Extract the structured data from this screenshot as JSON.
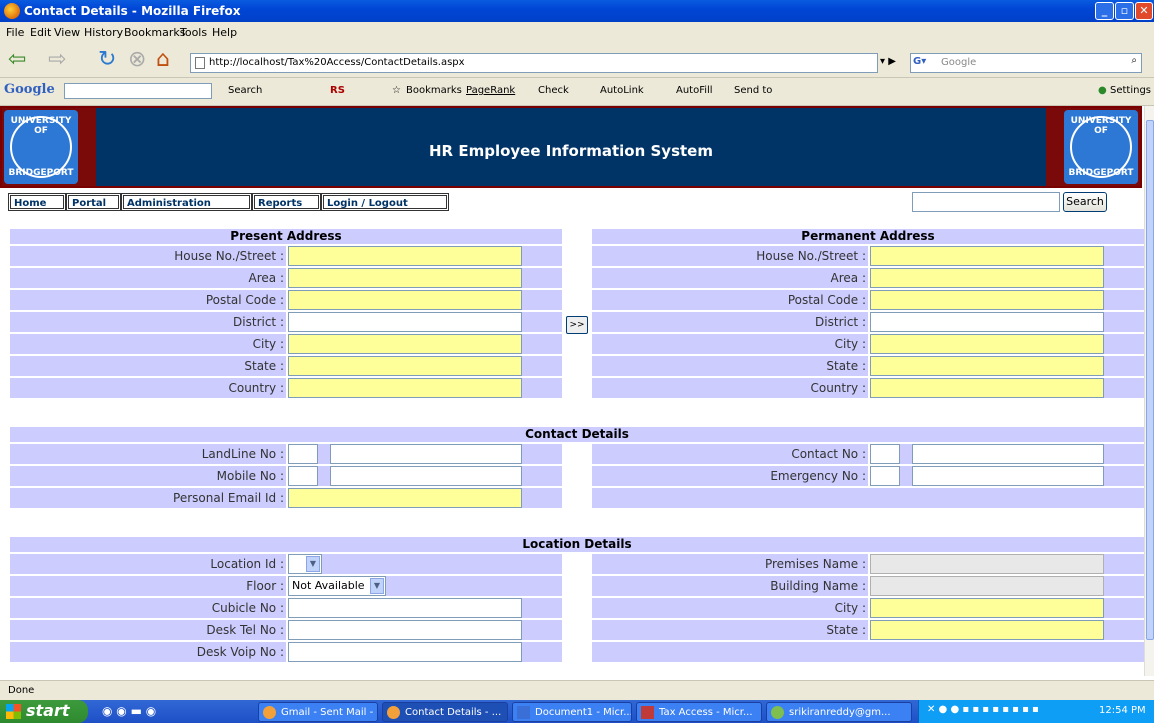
{
  "window": {
    "title": "Contact Details - Mozilla Firefox"
  },
  "menu": [
    "File",
    "Edit",
    "View",
    "History",
    "Bookmarks",
    "Tools",
    "Help"
  ],
  "address_url": "http://localhost/Tax%20Access/ContactDetails.aspx",
  "google_search_placeholder": "Google",
  "google_toolbar": {
    "brand": "Google",
    "search": "Search",
    "rs": "RS",
    "bookmarks": "Bookmarks",
    "pagerank": "PageRank",
    "check": "Check",
    "autolink": "AutoLink",
    "autofill": "AutoFill",
    "sendto": "Send to",
    "settings": "Settings"
  },
  "header": {
    "title": "HR Employee Information System",
    "logo_top": "UNIVERSITY OF",
    "logo_bottom": "BRIDGEPORT"
  },
  "nav": [
    "Home",
    "Portal",
    "Administration",
    "Reports",
    "Login / Logout"
  ],
  "search_button": "Search",
  "copy_button": ">>",
  "sections": {
    "present": "Present Address",
    "permanent": "Permanent Address",
    "contact": "Contact Details",
    "location": "Location Details"
  },
  "address_labels": [
    "House No./Street :",
    "Area :",
    "Postal Code :",
    "District :",
    "City :",
    "State :",
    "Country :"
  ],
  "contact_left": [
    "LandLine No :",
    "Mobile No :",
    "Personal Email Id :"
  ],
  "contact_right": [
    "Contact No :",
    "Emergency No :"
  ],
  "location_left": [
    "Location Id :",
    "Floor :",
    "Cubicle No :",
    "Desk Tel No :",
    "Desk Voip No :"
  ],
  "location_right": [
    "Premises Name :",
    "Building Name :",
    "City :",
    "State :"
  ],
  "floor_value": "Not Available",
  "status": "Done",
  "taskbar": {
    "start": "start",
    "buttons": [
      "Gmail - Sent Mail - ...",
      "Contact Details - ...",
      "Document1 - Micr...",
      "Tax Access - Micr...",
      "srikiranreddy@gm..."
    ],
    "clock": "12:54 PM"
  }
}
